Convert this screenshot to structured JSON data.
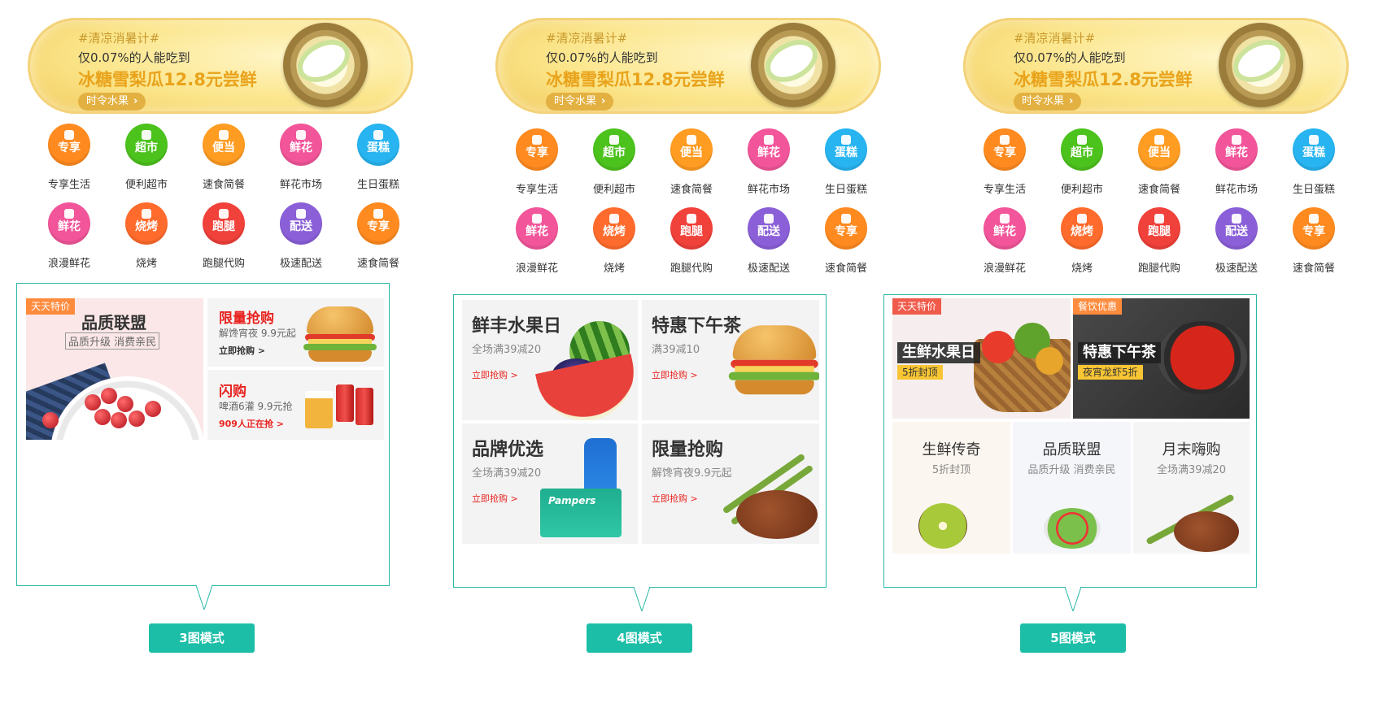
{
  "banner": {
    "tag": "#清凉消暑计#",
    "line1": "仅0.07%的人能吃到",
    "line2": "冰糖雪梨瓜12.8元尝鲜",
    "button": "时令水果"
  },
  "categories_row1": [
    "专享生活",
    "便利超市",
    "速食简餐",
    "鲜花市场",
    "生日蛋糕"
  ],
  "categories_row1_icon_text": [
    "专享",
    "超市",
    "便当",
    "鲜花",
    "蛋糕"
  ],
  "categories_row2": [
    "浪漫鲜花",
    "烧烤",
    "跑腿代购",
    "极速配送",
    "速食简餐"
  ],
  "categories_row2_icon_text": [
    "鲜花",
    "烧烤",
    "跑腿",
    "配送",
    "专享"
  ],
  "colors": {
    "orange": "#ff8a1f",
    "green": "#4cc21d",
    "pink": "#f2559a",
    "blue": "#27b4f0",
    "red": "#f0413a",
    "purple": "#8a5fd8",
    "teal": "#1dbea8"
  },
  "mode3": {
    "label": "3图模式",
    "big": {
      "badge": "天天特价",
      "title": "品质联盟",
      "sub": "品质升级 消费亲民"
    },
    "top": {
      "title": "限量抢购",
      "sub": "解馋宵夜 9.9元起",
      "link": "立即抢购 >"
    },
    "bottom": {
      "title": "闪购",
      "sub": "啤酒6灌 9.9元抢",
      "link": "909人正在抢 >"
    }
  },
  "mode4": {
    "label": "4图模式",
    "tiles": [
      {
        "title": "鲜丰水果日",
        "sub": "全场满39减20",
        "link": "立即抢购 >"
      },
      {
        "title": "特惠下午茶",
        "sub": "满39减10",
        "link": "立即抢购 >"
      },
      {
        "title": "品牌优选",
        "sub": "全场满39减20",
        "link": "立即抢购 >",
        "brand": "Pampers"
      },
      {
        "title": "限量抢购",
        "sub": "解馋宵夜9.9元起",
        "link": "立即抢购 >"
      }
    ]
  },
  "mode5": {
    "label": "5图模式",
    "left": {
      "badge": "天天特价",
      "title": "生鲜水果日",
      "sub": "5折封顶"
    },
    "right": {
      "badge": "餐饮优惠",
      "title": "特惠下午茶",
      "sub": "夜宵龙虾5折"
    },
    "bottom": [
      {
        "title": "生鲜传奇",
        "sub": "5折封顶"
      },
      {
        "title": "品质联盟",
        "sub": "品质升级 消费亲民"
      },
      {
        "title": "月末嗨购",
        "sub": "全场满39减20"
      }
    ]
  }
}
